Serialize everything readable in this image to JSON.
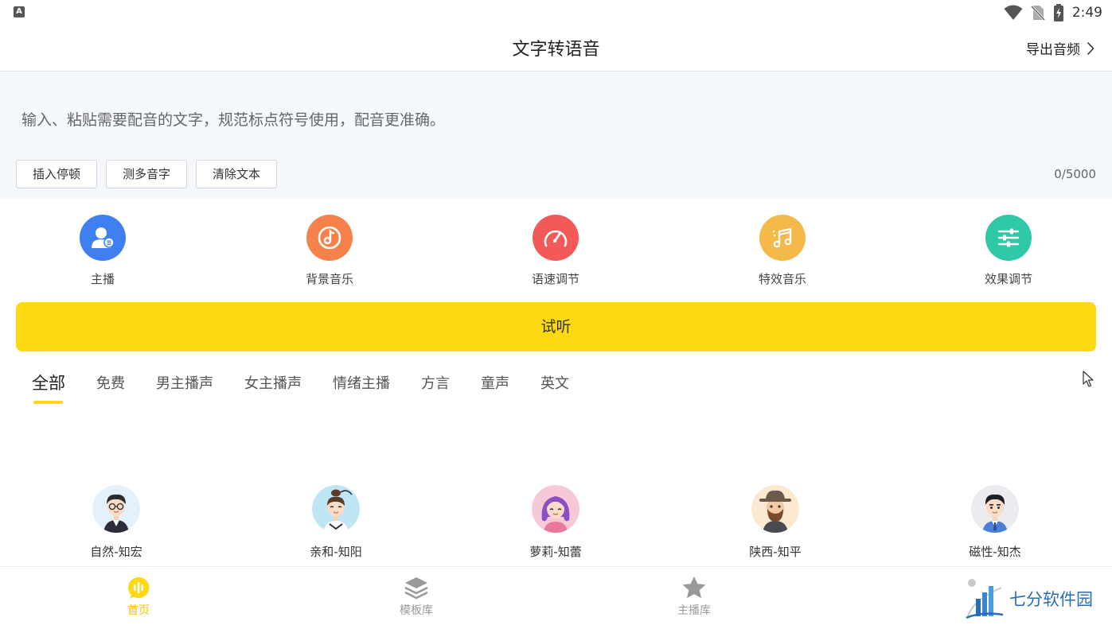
{
  "status_bar": {
    "time": "2:49",
    "notification_letter": "A"
  },
  "header": {
    "title": "文字转语音",
    "export_label": "导出音频"
  },
  "editor": {
    "placeholder": "输入、粘贴需要配音的文字，规范标点符号使用，配音更准确。",
    "buttons": [
      {
        "label": "插入停顿"
      },
      {
        "label": "测多音字"
      },
      {
        "label": "清除文本"
      }
    ],
    "char_count": "0/5000"
  },
  "features": [
    {
      "label": "主播",
      "icon": "anchor-icon",
      "color": "#3f7ff0"
    },
    {
      "label": "背景音乐",
      "icon": "music-disc-icon",
      "color": "#f5824a"
    },
    {
      "label": "语速调节",
      "icon": "speed-gauge-icon",
      "color": "#f25a5a"
    },
    {
      "label": "特效音乐",
      "icon": "music-note-icon",
      "color": "#f5b94a"
    },
    {
      "label": "效果调节",
      "icon": "sliders-icon",
      "color": "#30c9a7"
    }
  ],
  "listen_label": "试听",
  "tabs": [
    {
      "label": "全部",
      "active": true
    },
    {
      "label": "免费"
    },
    {
      "label": "男主播声"
    },
    {
      "label": "女主播声"
    },
    {
      "label": "情绪主播"
    },
    {
      "label": "方言"
    },
    {
      "label": "童声"
    },
    {
      "label": "英文"
    }
  ],
  "voices": [
    {
      "name": "自然-知宏"
    },
    {
      "name": "亲和-知阳"
    },
    {
      "name": "萝莉-知蕾"
    },
    {
      "name": "陕西-知平"
    },
    {
      "name": "磁性-知杰"
    }
  ],
  "bottom_nav": [
    {
      "label": "首页",
      "icon": "home-mic-icon",
      "active": true
    },
    {
      "label": "模板库",
      "icon": "layers-icon"
    },
    {
      "label": "主播库",
      "icon": "star-icon"
    }
  ],
  "watermark": {
    "text": "七分软件园"
  },
  "colors": {
    "accent": "#fcd913",
    "nav_active": "#f5c400",
    "editor_bg": "#f5f8fd"
  }
}
